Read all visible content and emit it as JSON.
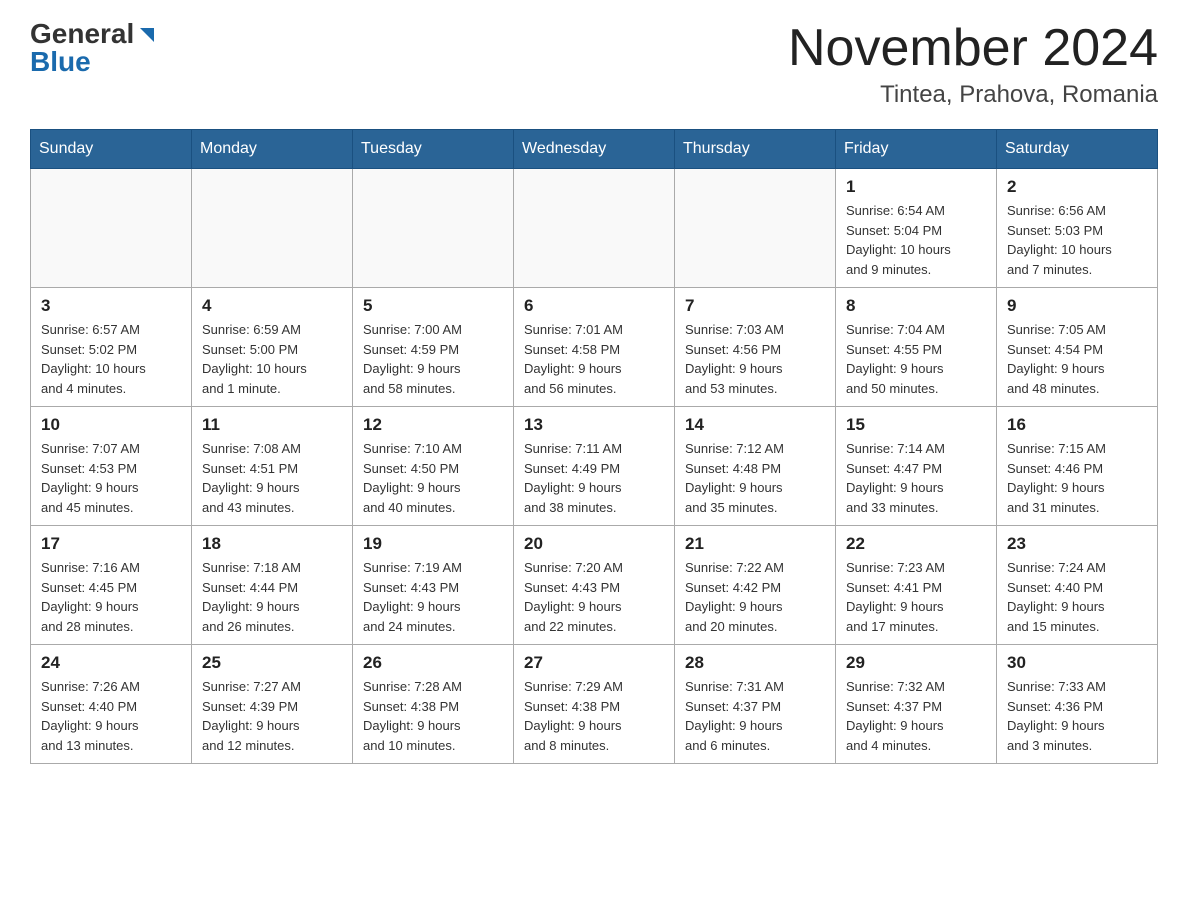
{
  "logo": {
    "general": "General",
    "blue": "Blue",
    "triangle": "▶"
  },
  "header": {
    "month_title": "November 2024",
    "location": "Tintea, Prahova, Romania"
  },
  "weekdays": [
    "Sunday",
    "Monday",
    "Tuesday",
    "Wednesday",
    "Thursday",
    "Friday",
    "Saturday"
  ],
  "weeks": [
    [
      {
        "day": "",
        "info": ""
      },
      {
        "day": "",
        "info": ""
      },
      {
        "day": "",
        "info": ""
      },
      {
        "day": "",
        "info": ""
      },
      {
        "day": "",
        "info": ""
      },
      {
        "day": "1",
        "info": "Sunrise: 6:54 AM\nSunset: 5:04 PM\nDaylight: 10 hours\nand 9 minutes."
      },
      {
        "day": "2",
        "info": "Sunrise: 6:56 AM\nSunset: 5:03 PM\nDaylight: 10 hours\nand 7 minutes."
      }
    ],
    [
      {
        "day": "3",
        "info": "Sunrise: 6:57 AM\nSunset: 5:02 PM\nDaylight: 10 hours\nand 4 minutes."
      },
      {
        "day": "4",
        "info": "Sunrise: 6:59 AM\nSunset: 5:00 PM\nDaylight: 10 hours\nand 1 minute."
      },
      {
        "day": "5",
        "info": "Sunrise: 7:00 AM\nSunset: 4:59 PM\nDaylight: 9 hours\nand 58 minutes."
      },
      {
        "day": "6",
        "info": "Sunrise: 7:01 AM\nSunset: 4:58 PM\nDaylight: 9 hours\nand 56 minutes."
      },
      {
        "day": "7",
        "info": "Sunrise: 7:03 AM\nSunset: 4:56 PM\nDaylight: 9 hours\nand 53 minutes."
      },
      {
        "day": "8",
        "info": "Sunrise: 7:04 AM\nSunset: 4:55 PM\nDaylight: 9 hours\nand 50 minutes."
      },
      {
        "day": "9",
        "info": "Sunrise: 7:05 AM\nSunset: 4:54 PM\nDaylight: 9 hours\nand 48 minutes."
      }
    ],
    [
      {
        "day": "10",
        "info": "Sunrise: 7:07 AM\nSunset: 4:53 PM\nDaylight: 9 hours\nand 45 minutes."
      },
      {
        "day": "11",
        "info": "Sunrise: 7:08 AM\nSunset: 4:51 PM\nDaylight: 9 hours\nand 43 minutes."
      },
      {
        "day": "12",
        "info": "Sunrise: 7:10 AM\nSunset: 4:50 PM\nDaylight: 9 hours\nand 40 minutes."
      },
      {
        "day": "13",
        "info": "Sunrise: 7:11 AM\nSunset: 4:49 PM\nDaylight: 9 hours\nand 38 minutes."
      },
      {
        "day": "14",
        "info": "Sunrise: 7:12 AM\nSunset: 4:48 PM\nDaylight: 9 hours\nand 35 minutes."
      },
      {
        "day": "15",
        "info": "Sunrise: 7:14 AM\nSunset: 4:47 PM\nDaylight: 9 hours\nand 33 minutes."
      },
      {
        "day": "16",
        "info": "Sunrise: 7:15 AM\nSunset: 4:46 PM\nDaylight: 9 hours\nand 31 minutes."
      }
    ],
    [
      {
        "day": "17",
        "info": "Sunrise: 7:16 AM\nSunset: 4:45 PM\nDaylight: 9 hours\nand 28 minutes."
      },
      {
        "day": "18",
        "info": "Sunrise: 7:18 AM\nSunset: 4:44 PM\nDaylight: 9 hours\nand 26 minutes."
      },
      {
        "day": "19",
        "info": "Sunrise: 7:19 AM\nSunset: 4:43 PM\nDaylight: 9 hours\nand 24 minutes."
      },
      {
        "day": "20",
        "info": "Sunrise: 7:20 AM\nSunset: 4:43 PM\nDaylight: 9 hours\nand 22 minutes."
      },
      {
        "day": "21",
        "info": "Sunrise: 7:22 AM\nSunset: 4:42 PM\nDaylight: 9 hours\nand 20 minutes."
      },
      {
        "day": "22",
        "info": "Sunrise: 7:23 AM\nSunset: 4:41 PM\nDaylight: 9 hours\nand 17 minutes."
      },
      {
        "day": "23",
        "info": "Sunrise: 7:24 AM\nSunset: 4:40 PM\nDaylight: 9 hours\nand 15 minutes."
      }
    ],
    [
      {
        "day": "24",
        "info": "Sunrise: 7:26 AM\nSunset: 4:40 PM\nDaylight: 9 hours\nand 13 minutes."
      },
      {
        "day": "25",
        "info": "Sunrise: 7:27 AM\nSunset: 4:39 PM\nDaylight: 9 hours\nand 12 minutes."
      },
      {
        "day": "26",
        "info": "Sunrise: 7:28 AM\nSunset: 4:38 PM\nDaylight: 9 hours\nand 10 minutes."
      },
      {
        "day": "27",
        "info": "Sunrise: 7:29 AM\nSunset: 4:38 PM\nDaylight: 9 hours\nand 8 minutes."
      },
      {
        "day": "28",
        "info": "Sunrise: 7:31 AM\nSunset: 4:37 PM\nDaylight: 9 hours\nand 6 minutes."
      },
      {
        "day": "29",
        "info": "Sunrise: 7:32 AM\nSunset: 4:37 PM\nDaylight: 9 hours\nand 4 minutes."
      },
      {
        "day": "30",
        "info": "Sunrise: 7:33 AM\nSunset: 4:36 PM\nDaylight: 9 hours\nand 3 minutes."
      }
    ]
  ]
}
